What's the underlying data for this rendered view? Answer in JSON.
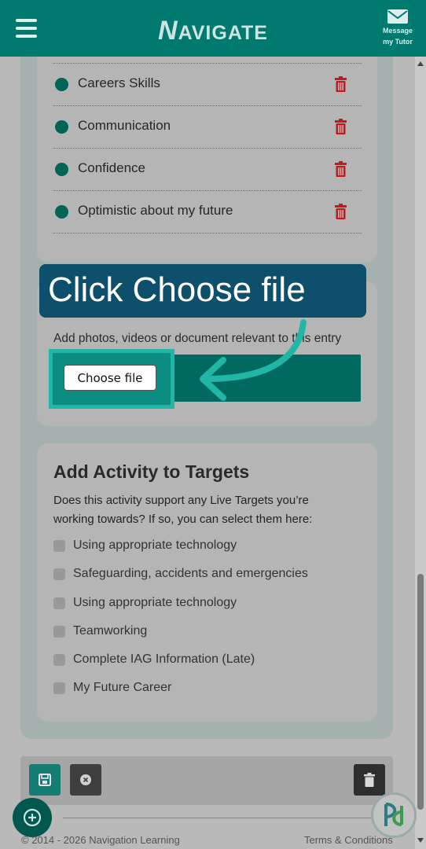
{
  "header": {
    "logo_initial": "N",
    "logo_rest": "AVIGATE",
    "message_line1": "Message",
    "message_line2": "my Tutor"
  },
  "targets_list": [
    {
      "label": "Careers Skills"
    },
    {
      "label": "Communication"
    },
    {
      "label": "Confidence"
    },
    {
      "label": "Optimistic about my future"
    }
  ],
  "callout": {
    "text": "Click Choose file"
  },
  "upload": {
    "description": "Add photos, videos or document relevant to this entry",
    "button_label": "Choose file"
  },
  "add_targets": {
    "title": "Add Activity to Targets",
    "question": "Does this activity support any Live Targets you’re working towards? If so, you can select them here:",
    "options": [
      {
        "label": "Using appropriate technology"
      },
      {
        "label": "Safeguarding, accidents and emergencies"
      },
      {
        "label": "Using appropriate technology"
      },
      {
        "label": "Teamworking"
      },
      {
        "label": "Complete IAG Information (Late)"
      },
      {
        "label": "My Future Career"
      }
    ]
  },
  "footer": {
    "copyright": "© 2014 - 2026 Navigation Learning",
    "terms": "Terms & Conditions"
  },
  "colors": {
    "header": "#00796e",
    "accent": "#21b6a6",
    "callout": "#0e4f6c",
    "delete": "#c4181f"
  }
}
